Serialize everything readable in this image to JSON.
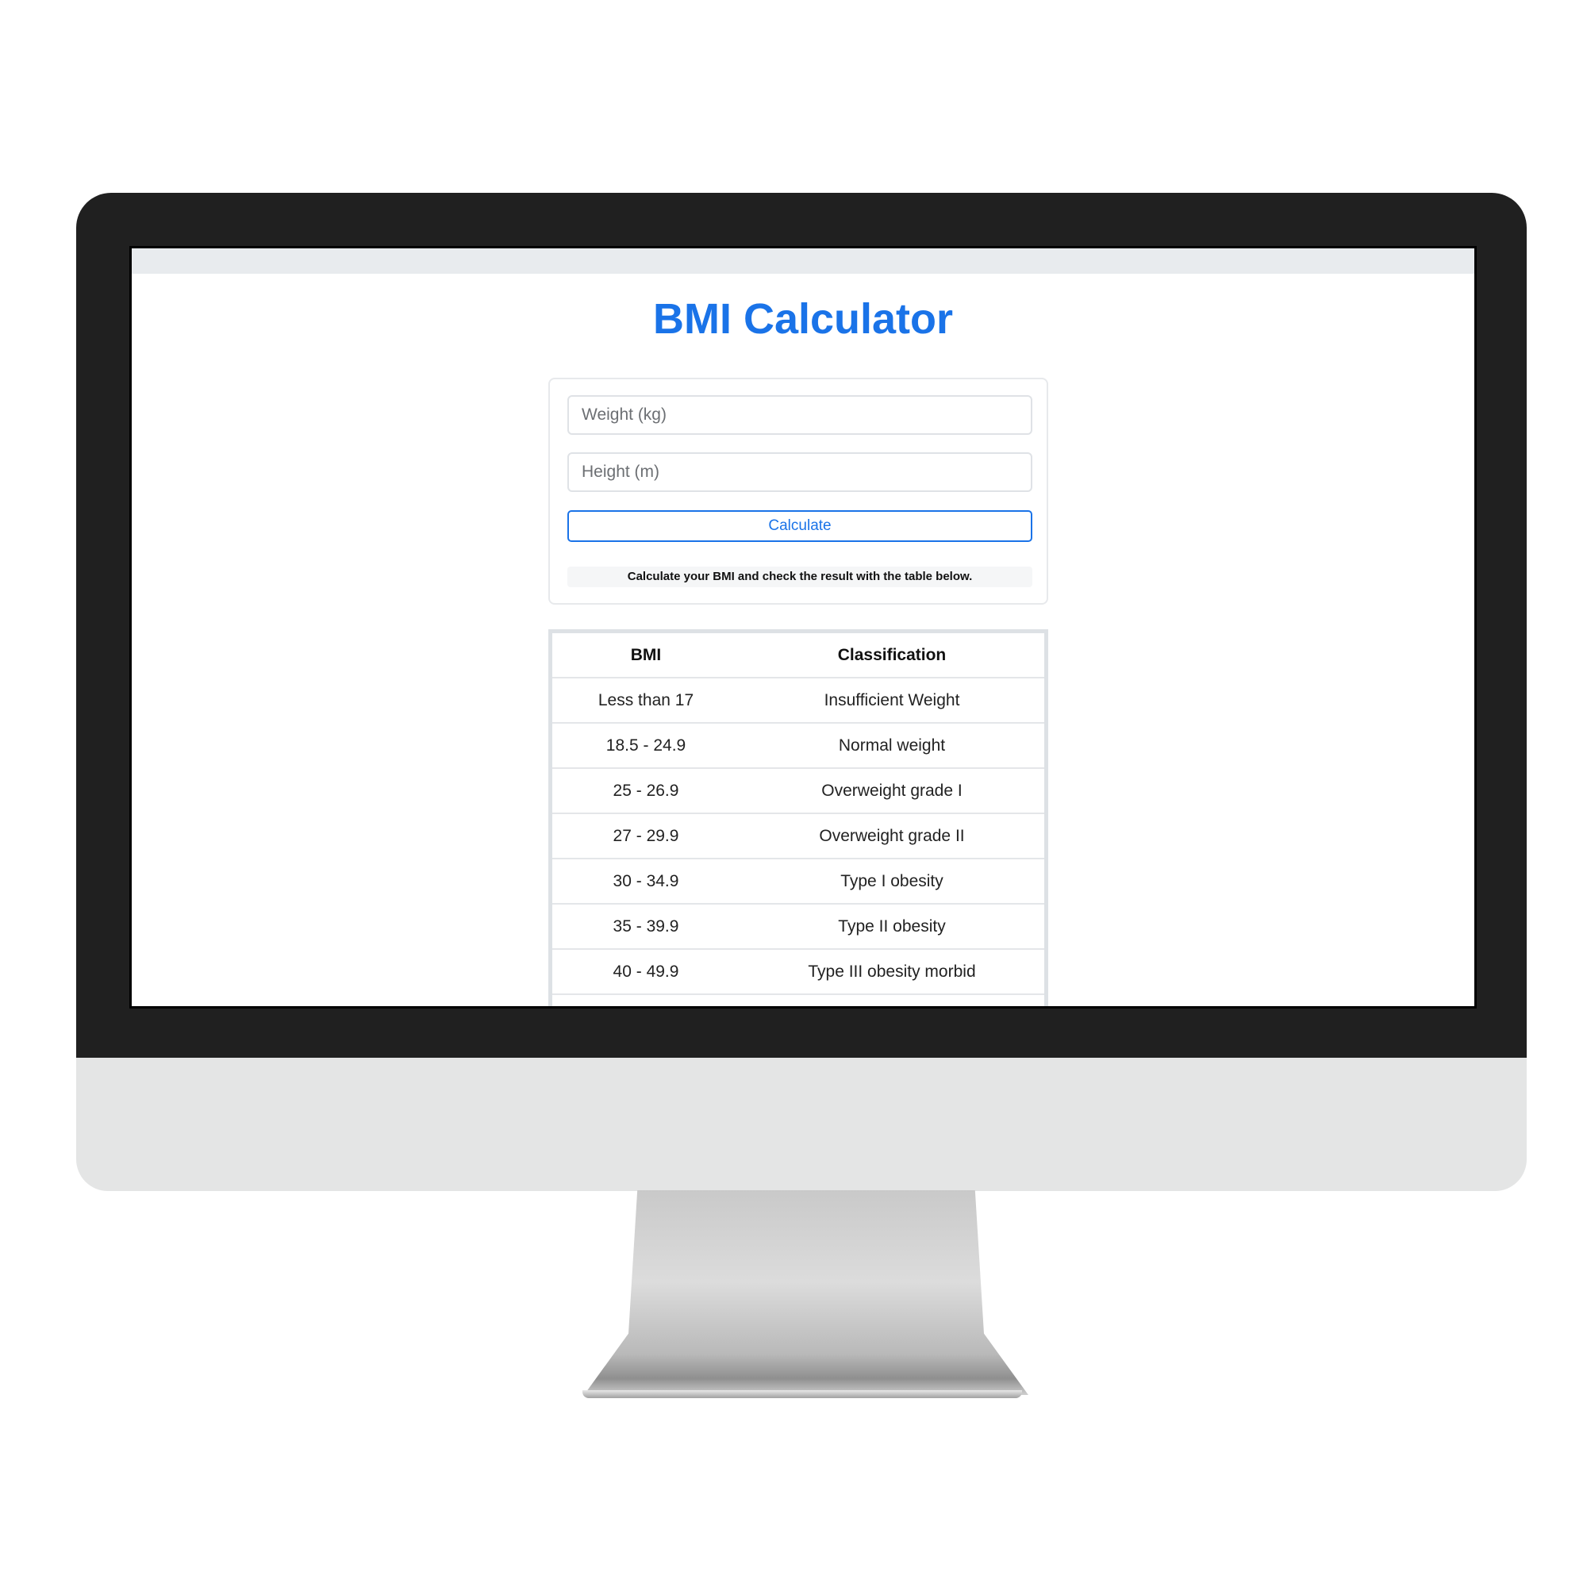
{
  "app": {
    "title": "BMI Calculator"
  },
  "form": {
    "weight_placeholder": "Weight (kg)",
    "weight_value": "",
    "height_placeholder": "Height (m)",
    "height_value": "",
    "calculate_label": "Calculate",
    "result_text": "Calculate your BMI and check the result with the table below."
  },
  "table": {
    "headers": [
      "BMI",
      "Classification"
    ],
    "rows": [
      [
        "Less than 17",
        "Insufficient Weight"
      ],
      [
        "18.5 - 24.9",
        "Normal weight"
      ],
      [
        "25 - 26.9",
        "Overweight grade I"
      ],
      [
        "27 - 29.9",
        "Overweight grade II"
      ],
      [
        "30 - 34.9",
        "Type I obesity"
      ],
      [
        "35 - 39.9",
        "Type II obesity"
      ],
      [
        "40 - 49.9",
        "Type III obesity morbid"
      ]
    ]
  },
  "colors": {
    "accent": "#1a73e8",
    "bezel": "#202020",
    "chin": "#e4e5e5"
  }
}
